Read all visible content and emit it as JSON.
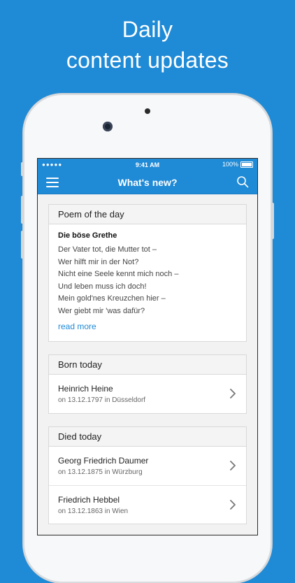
{
  "headline": {
    "line1": "Daily",
    "line2": "content updates"
  },
  "statusbar": {
    "signal": "●●●●● ",
    "time": "9:41 AM",
    "battery": "100%"
  },
  "navbar": {
    "title": "What's new?"
  },
  "poem_card": {
    "header": "Poem of the day",
    "title": "Die böse Grethe",
    "lines": [
      "Der Vater tot, die Mutter tot –",
      "Wer hilft mir in der Not?",
      "Nicht eine Seele kennt mich noch –",
      "Und leben muss ich doch!",
      "Mein gold'nes Kreuzchen hier –",
      "Wer giebt mir 'was dafür?"
    ],
    "read_more": "read more"
  },
  "born_card": {
    "header": "Born today",
    "people": [
      {
        "name": "Heinrich Heine",
        "detail": "on 13.12.1797 in Düsseldorf"
      }
    ]
  },
  "died_card": {
    "header": "Died today",
    "people": [
      {
        "name": "Georg Friedrich Daumer",
        "detail": "on 13.12.1875 in Würzburg"
      },
      {
        "name": "Friedrich Hebbel",
        "detail": "on 13.12.1863 in Wien"
      }
    ]
  },
  "colors": {
    "accent": "#1f8ad6",
    "background": "#1f8ad6",
    "card_header": "#f4f4f4",
    "link": "#1f8ad6"
  }
}
